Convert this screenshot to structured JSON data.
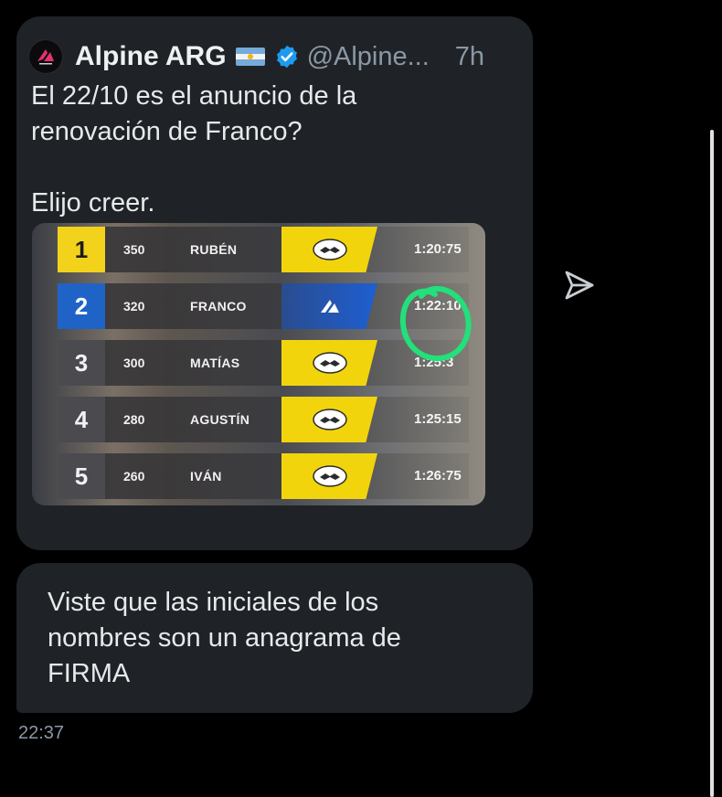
{
  "tweet": {
    "author_name": "Alpine ARG",
    "handle": "@Alpine...",
    "time": "7h",
    "text": "El 22/10 es el anuncio de la\nrenovación de Franco?\n\nElijo creer.",
    "flag_icon": "argentina-flag-icon",
    "verified_icon": "verified-badge-icon",
    "avatar_icon": "alpine-logo-icon",
    "image": {
      "rows": [
        {
          "position": "1",
          "points": "350",
          "name": "RUBÉN",
          "time": "1:20:75",
          "sponsor": "handshake-logo-icon"
        },
        {
          "position": "2",
          "points": "320",
          "name": "FRANCO",
          "time": "1:22:10",
          "sponsor": "alpine-a-logo-icon"
        },
        {
          "position": "3",
          "points": "300",
          "name": "MATÍAS",
          "time": "1:25:3",
          "sponsor": "handshake-logo-icon"
        },
        {
          "position": "4",
          "points": "280",
          "name": "AGUSTÍN",
          "time": "1:25:15",
          "sponsor": "handshake-logo-icon"
        },
        {
          "position": "5",
          "points": "260",
          "name": "IVÁN",
          "time": "1:26:75",
          "sponsor": "handshake-logo-icon"
        }
      ]
    }
  },
  "reply": {
    "text": "Viste que las iniciales de los\nnombres son un anagrama de\nFIRMA"
  },
  "timestamp": "22:37",
  "icons": {
    "send": "send-icon"
  },
  "colors": {
    "bubble": "#1f2327",
    "yellow": "#f2d40d",
    "blue": "#1f63c7",
    "annotation": "#22e07a",
    "verified": "#1d9bf0"
  }
}
